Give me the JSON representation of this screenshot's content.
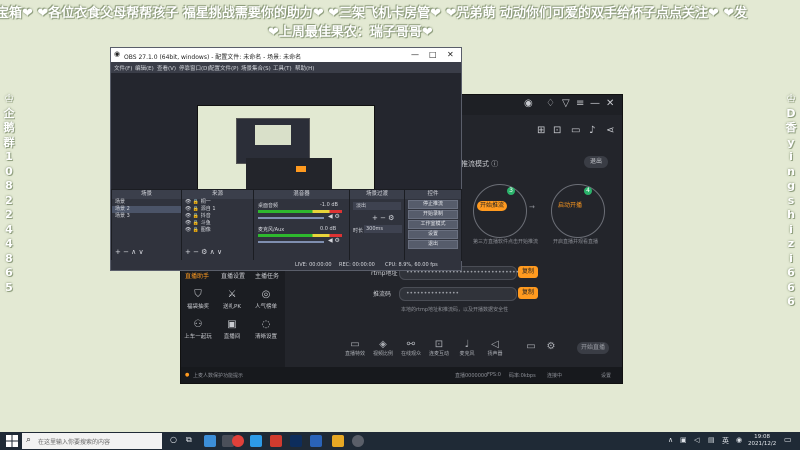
{
  "overlay": {
    "line1": "宝箱❤ ❤各位衣食父母帮帮孩子 福星挑战需要你的助力❤ ❤三架飞机卡房管❤ ❤咒弟萌 动动你们可爱的双手给杯子点点关注❤ ❤发",
    "line2": "❤上周最佳果农：瑞子哥哥❤",
    "left_vertical": [
      "♔",
      "企",
      "鹅",
      "群",
      "1",
      "0",
      "8",
      "2",
      "2",
      "4",
      "4",
      "8",
      "6",
      "5"
    ],
    "right_vertical": [
      "♔",
      "D",
      "香",
      "y",
      "i",
      "n",
      "g",
      "s",
      "h",
      "i",
      "z",
      "i",
      "6",
      "6",
      "6"
    ]
  },
  "obs": {
    "title": "OBS 27.1.0 (64bit, windows) - 配置文件: 未命名 - 场景: 未命名",
    "menu": [
      "文件(F)",
      "编辑(E)",
      "查看(V)",
      "停靠窗口(D)",
      "配置文件(P)",
      "场景集合(S)",
      "工具(T)",
      "帮助(H)"
    ],
    "docks": {
      "scenes": {
        "title": "场景",
        "items": [
          "场景",
          "场景 2",
          "场景 3"
        ]
      },
      "sources": {
        "title": "来源",
        "items": [
          "桐一",
          "源自 1",
          "抖音",
          "斗鱼",
          "图像"
        ]
      },
      "mixer": {
        "title": "混音器",
        "items": [
          "桌面音频",
          "麦克风/Aux"
        ],
        "levels": [
          "-1.0 dB",
          "0.0 dB"
        ]
      },
      "transitions": {
        "title": "场景过渡",
        "type": "淡出",
        "duration_label": "时长",
        "duration": "300ms"
      },
      "controls": {
        "title": "控件",
        "buttons": [
          "停止推流",
          "开始录制",
          "工作室模式",
          "设置",
          "退出"
        ]
      }
    },
    "status": {
      "live": "LIVE: 00:00:00",
      "rec": "REC: 00:00:00",
      "cpu": "CPU: 8.9%, 60.00 fps"
    }
  },
  "stream_app": {
    "mode_label": "推流模式",
    "exit_label": "退出",
    "step3": {
      "num": "3",
      "button": "开始推流",
      "desc": "第三方直播软件点击开始推流"
    },
    "step4": {
      "num": "4",
      "button": "启动开播",
      "desc": "开启直播并观看直播"
    },
    "server_label": "rtmp地址",
    "server_value": "••••••••••••••••••••••••••••••••",
    "server_copy": "复制",
    "key_label": "推流码",
    "key_value": "•••••••••••••••",
    "key_copy": "复制",
    "note": "本地的rtmp地址和推流码，以及开播数据安全性",
    "left_tabs": [
      "直播助手",
      "直播设置",
      "主播任务"
    ],
    "tools": [
      "福袋抽奖",
      "送礼PK",
      "人气榜单",
      "上车一起玩",
      "直播间",
      "清晰设置"
    ],
    "bottom_items": [
      "直播特效",
      "视频比例",
      "在线观众",
      "连麦互动",
      "麦克风",
      "扬声器"
    ],
    "start_label": "开始直播",
    "status_left": "上麦人数保护功能提示",
    "status_right": [
      "直播0000000",
      "FPS:0",
      "码率:0kbps",
      "连接中",
      "设置"
    ]
  },
  "taskbar": {
    "search_placeholder": "在这里输入你要搜索的内容",
    "clock_time": "19:08",
    "clock_date": "2021/12/2"
  },
  "colors": {
    "accent": "#ff9a1f",
    "app_bg": "#23252b",
    "desktop": "#e3e9d3",
    "taskbar": "#1f2a36"
  }
}
